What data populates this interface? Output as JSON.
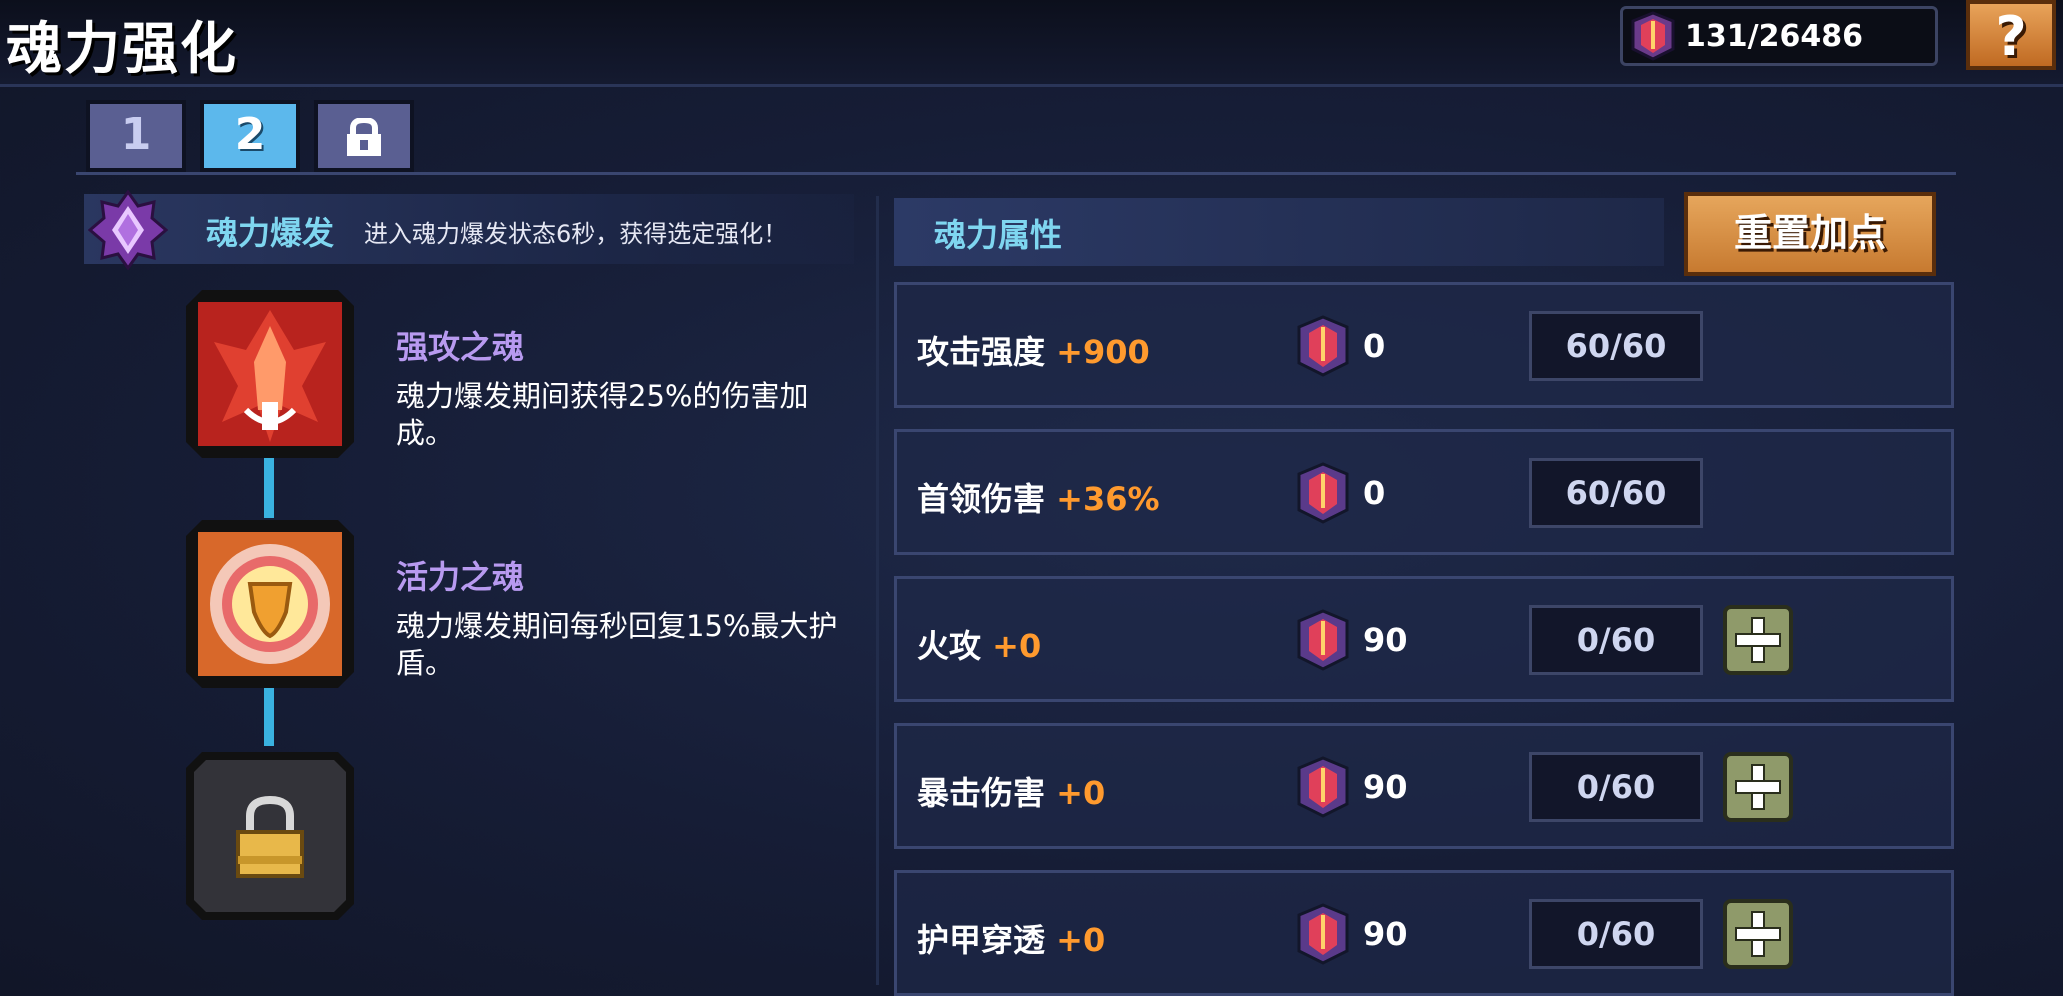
{
  "header": {
    "title": "魂力强化",
    "currency": "131/26486",
    "help_label": "?"
  },
  "tabs": [
    {
      "label": "1"
    },
    {
      "label": "2"
    },
    {
      "label": "lock-icon"
    }
  ],
  "burst": {
    "title": "魂力爆发",
    "desc": "进入魂力爆发状态6秒，获得选定强化！"
  },
  "skills": [
    {
      "name": "强攻之魂",
      "desc": "魂力爆发期间获得25%的伤害加成。",
      "icon": "attack-soul-icon"
    },
    {
      "name": "活力之魂",
      "desc": "魂力爆发期间每秒回复15%最大护盾。",
      "icon": "vitality-soul-icon"
    },
    {
      "icon": "locked-slot-icon"
    }
  ],
  "attributes": {
    "title": "魂力属性",
    "reset_label": "重置加点",
    "rows": [
      {
        "label": "攻击强度 ",
        "bonus": "+900",
        "cost": "0",
        "level": "60/60",
        "has_plus": false
      },
      {
        "label": "首领伤害 ",
        "bonus": "+36%",
        "cost": "0",
        "level": "60/60",
        "has_plus": false
      },
      {
        "label": "火攻 ",
        "bonus": "+0",
        "cost": "90",
        "level": "0/60",
        "has_plus": true
      },
      {
        "label": "暴击伤害 ",
        "bonus": "+0",
        "cost": "90",
        "level": "0/60",
        "has_plus": true
      },
      {
        "label": "护甲穿透 ",
        "bonus": "+0",
        "cost": "90",
        "level": "0/60",
        "has_plus": true
      }
    ]
  },
  "colors": {
    "accent_cyan": "#7fd6f0",
    "bonus_orange": "#ff9a2e",
    "skill_purple": "#b89af0",
    "button_orange": "#d98a3e"
  }
}
